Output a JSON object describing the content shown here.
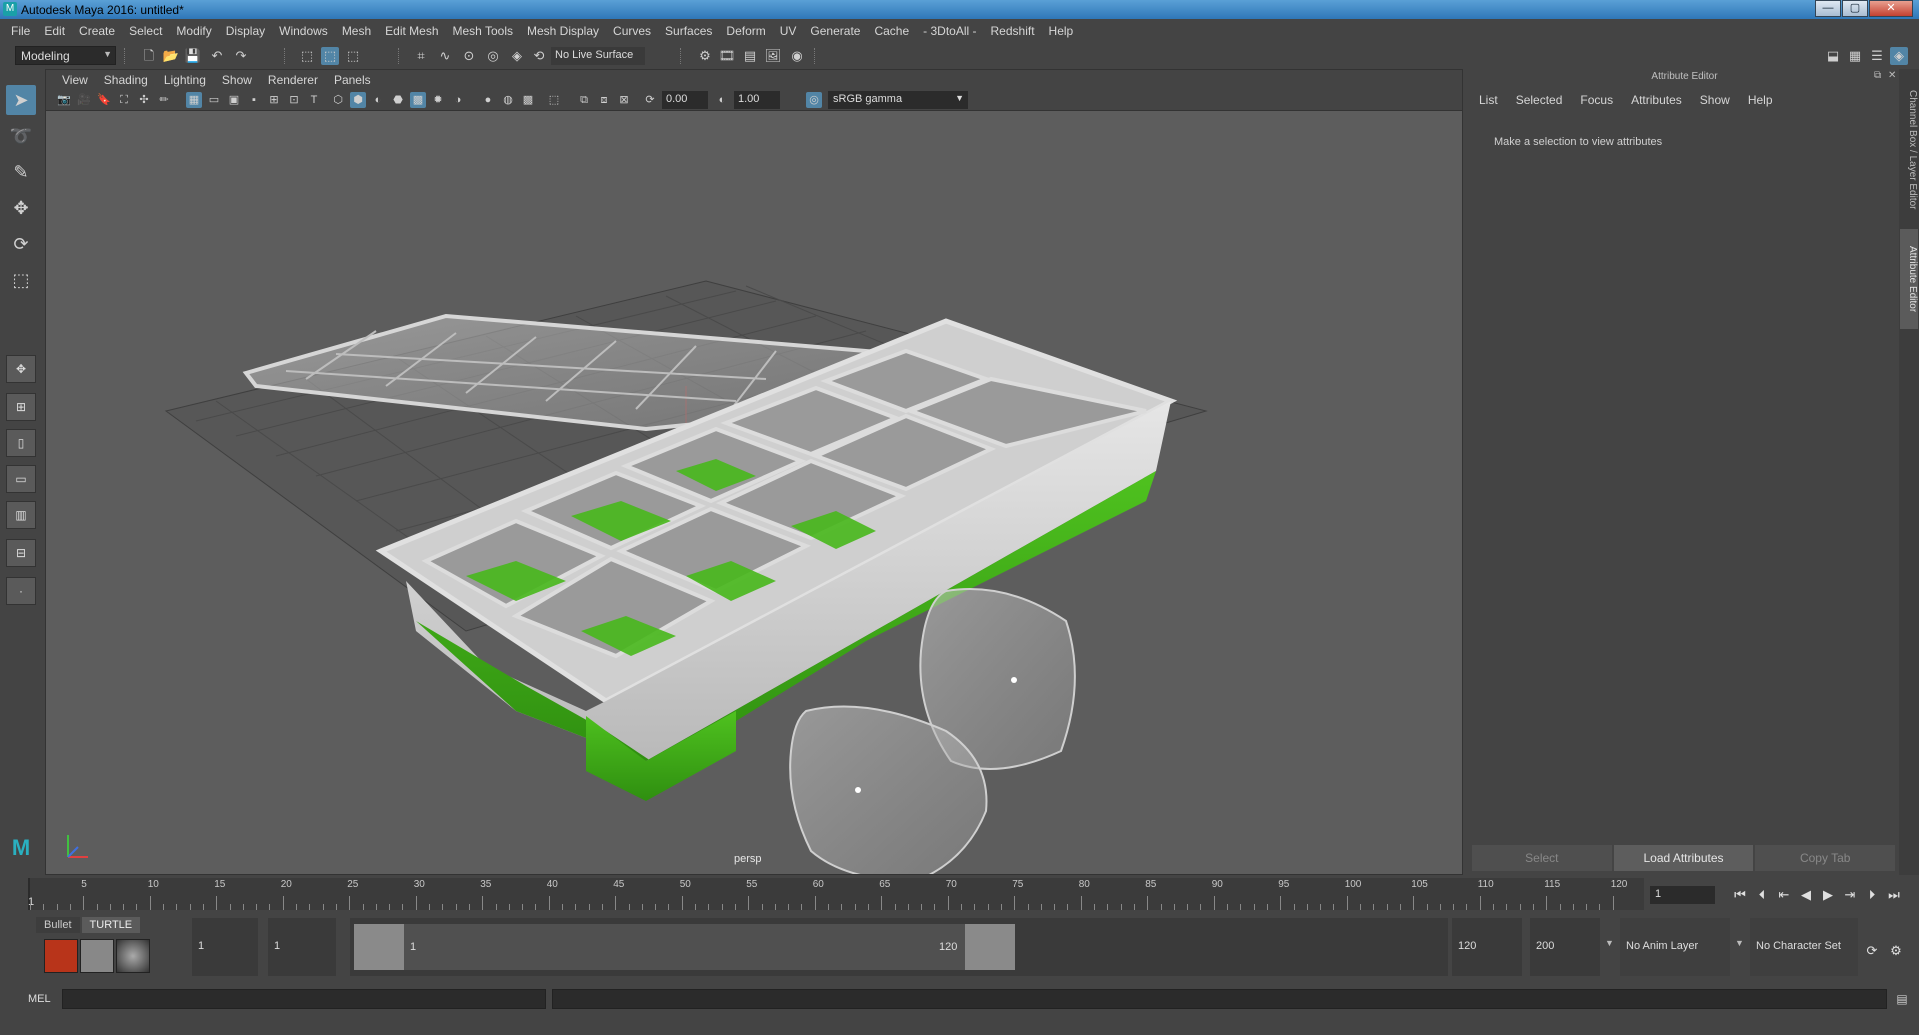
{
  "window": {
    "title": "Autodesk Maya 2016: untitled*",
    "minimize": "—",
    "maximize": "▢",
    "close": "✕"
  },
  "menubar": [
    "File",
    "Edit",
    "Create",
    "Select",
    "Modify",
    "Display",
    "Windows",
    "Mesh",
    "Edit Mesh",
    "Mesh Tools",
    "Mesh Display",
    "Curves",
    "Surfaces",
    "Deform",
    "UV",
    "Generate",
    "Cache",
    "- 3DtoAll -",
    "Redshift",
    "Help"
  ],
  "statusline": {
    "mode": "Modeling",
    "live_surface": "No Live Surface"
  },
  "viewport": {
    "menus": [
      "View",
      "Shading",
      "Lighting",
      "Show",
      "Renderer",
      "Panels"
    ],
    "near_value": "0.00",
    "far_value": "1.00",
    "color_space": "sRGB gamma",
    "camera_label": "persp"
  },
  "attribute_editor": {
    "title": "Attribute Editor",
    "menus": [
      "List",
      "Selected",
      "Focus",
      "Attributes",
      "Show",
      "Help"
    ],
    "message": "Make a selection to view attributes",
    "buttons": {
      "select": "Select",
      "load": "Load Attributes",
      "copy": "Copy Tab"
    },
    "side_tabs": {
      "channel_box": "Channel Box / Layer Editor",
      "attribute_editor": "Attribute Editor"
    }
  },
  "timeline": {
    "current_frame": "1",
    "ticks": [
      "5",
      "10",
      "15",
      "20",
      "25",
      "30",
      "35",
      "40",
      "45",
      "50",
      "55",
      "60",
      "65",
      "70",
      "75",
      "80",
      "85",
      "90",
      "95",
      "100",
      "105",
      "110",
      "115",
      "120"
    ],
    "frame_field": "1"
  },
  "range": {
    "shelf_tabs": [
      "Bullet",
      "TURTLE"
    ],
    "start_time": "1",
    "playback_start": "1",
    "range_start": "1",
    "range_end": "120",
    "playback_end": "120",
    "end_time": "200",
    "anim_layer": "No Anim Layer",
    "character_set": "No Character Set"
  },
  "cmdline": {
    "label": "MEL"
  },
  "colors": {
    "accent": "#5285a6",
    "tray_green": "#3fae1a",
    "tray_white": "#d9d9d9",
    "viewport_bg": "#5d5d5d"
  }
}
